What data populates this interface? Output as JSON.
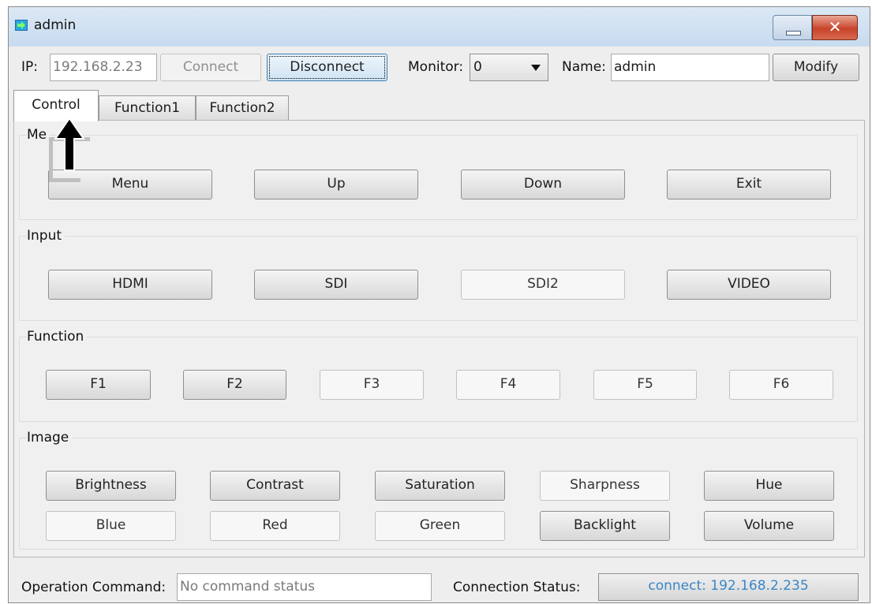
{
  "window": {
    "title": "admin"
  },
  "toolbar": {
    "ip_label": "IP:",
    "ip_value": "192.168.2.23",
    "connect_label": "Connect",
    "disconnect_label": "Disconnect",
    "monitor_label": "Monitor:",
    "monitor_value": "0",
    "name_label": "Name:",
    "name_value": "admin",
    "modify_label": "Modify"
  },
  "tabs": [
    {
      "label": "Control"
    },
    {
      "label": "Function1"
    },
    {
      "label": "Function2"
    }
  ],
  "groups": {
    "menu": {
      "label": "Me",
      "buttons": [
        "Menu",
        "Up",
        "Down",
        "Exit"
      ]
    },
    "input": {
      "label": "Input",
      "buttons": [
        "HDMI",
        "SDI",
        "SDI2",
        "VIDEO"
      ]
    },
    "function": {
      "label": "Function",
      "buttons": [
        "F1",
        "F2",
        "F3",
        "F4",
        "F5",
        "F6"
      ]
    },
    "image": {
      "label": "Image",
      "row1": [
        "Brightness",
        "Contrast",
        "Saturation",
        "Sharpness",
        "Hue"
      ],
      "row2": [
        "Blue",
        "Red",
        "Green",
        "Backlight",
        "Volume"
      ]
    }
  },
  "status": {
    "operation_label": "Operation Command:",
    "operation_value": "No command status",
    "connection_label": "Connection Status:",
    "connection_value": "connect: 192.168.2.235"
  },
  "icons": {
    "app": "arrow-right-icon",
    "overlay": "up-arrow-icon"
  },
  "colors": {
    "connection_text": "#3a86c8",
    "close_button": "#c8442a"
  }
}
